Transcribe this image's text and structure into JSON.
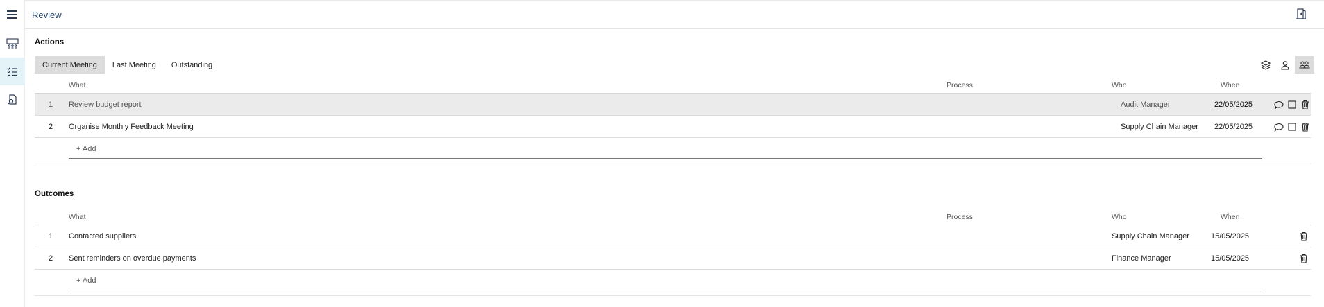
{
  "header": {
    "title": "Review"
  },
  "rail": {
    "items": [
      {
        "icon": "meeting-room-icon"
      },
      {
        "icon": "checklist-icon"
      },
      {
        "icon": "document-search-icon"
      }
    ]
  },
  "actions": {
    "title": "Actions",
    "tabs": [
      "Current Meeting",
      "Last Meeting",
      "Outstanding"
    ],
    "active_tab": "Current Meeting",
    "columns": {
      "what": "What",
      "process": "Process",
      "who": "Who",
      "when": "When"
    },
    "rows": [
      {
        "num": "1",
        "what": "Review budget report",
        "process": "",
        "who": "Audit Manager",
        "when": "22/05/2025"
      },
      {
        "num": "2",
        "what": "Organise Monthly Feedback Meeting",
        "process": "",
        "who": "Supply Chain Manager",
        "when": "22/05/2025"
      }
    ],
    "add_label": "+ Add"
  },
  "outcomes": {
    "title": "Outcomes",
    "columns": {
      "what": "What",
      "process": "Process",
      "who": "Who",
      "when": "When"
    },
    "rows": [
      {
        "num": "1",
        "what": "Contacted suppliers",
        "process": "",
        "who": "Supply Chain Manager",
        "when": "15/05/2025"
      },
      {
        "num": "2",
        "what": "Sent reminders on overdue payments",
        "process": "",
        "who": "Finance Manager",
        "when": "15/05/2025"
      }
    ],
    "add_label": "+ Add"
  },
  "colors": {
    "accent": "#1d3b63",
    "selected_nav": "#e3f3f8",
    "selected_row": "#ebebeb"
  }
}
